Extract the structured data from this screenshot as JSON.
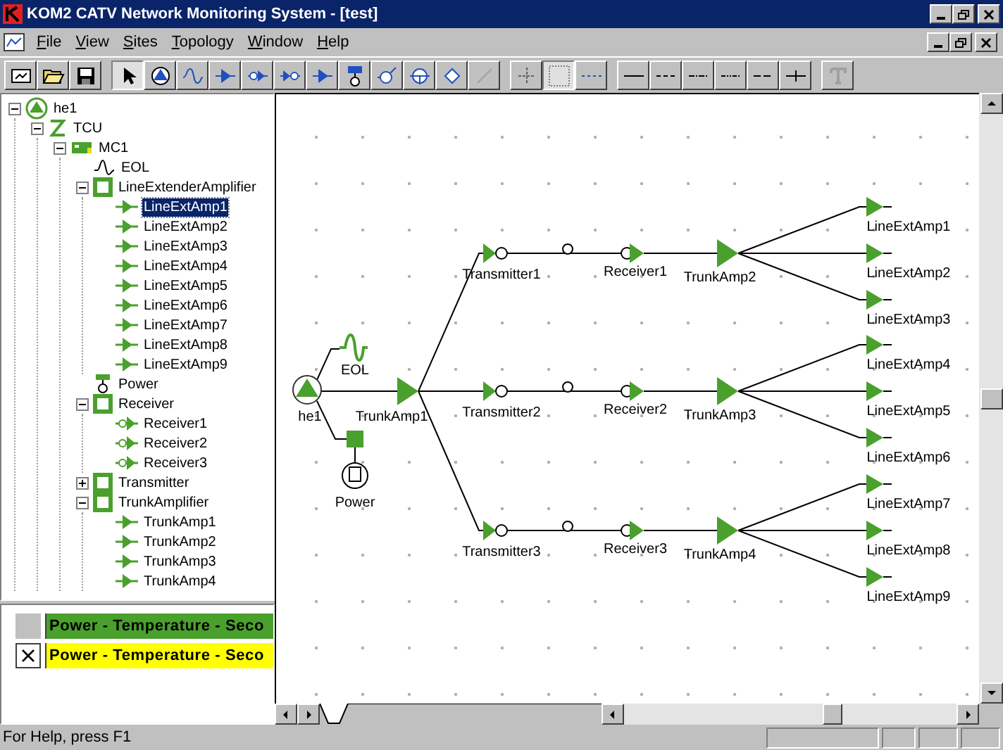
{
  "window": {
    "title": "KOM2 CATV Network Monitoring System - [test]"
  },
  "menu": [
    "File",
    "View",
    "Sites",
    "Topology",
    "Window",
    "Help"
  ],
  "toolbar": [
    {
      "kind": "new",
      "pressed": false
    },
    {
      "kind": "open",
      "pressed": false
    },
    {
      "kind": "save",
      "pressed": false
    },
    {
      "kind": "sep"
    },
    {
      "kind": "pointer",
      "pressed": true
    },
    {
      "kind": "headend",
      "pressed": false
    },
    {
      "kind": "eol",
      "pressed": false
    },
    {
      "kind": "amp",
      "pressed": false
    },
    {
      "kind": "receiver",
      "pressed": false
    },
    {
      "kind": "transmitter",
      "pressed": false
    },
    {
      "kind": "amp",
      "pressed": false
    },
    {
      "kind": "power",
      "pressed": false
    },
    {
      "kind": "tap",
      "pressed": false
    },
    {
      "kind": "node",
      "pressed": false
    },
    {
      "kind": "diamond",
      "pressed": false
    },
    {
      "kind": "line",
      "pressed": false
    },
    {
      "kind": "sep"
    },
    {
      "kind": "cross",
      "pressed": false
    },
    {
      "kind": "grid",
      "pressed": true
    },
    {
      "kind": "link",
      "pressed": false
    },
    {
      "kind": "sep"
    },
    {
      "kind": "solid",
      "pressed": false
    },
    {
      "kind": "dash",
      "pressed": false
    },
    {
      "kind": "dashdot",
      "pressed": false
    },
    {
      "kind": "dashdotdot",
      "pressed": false
    },
    {
      "kind": "longdash",
      "pressed": false
    },
    {
      "kind": "tee",
      "pressed": false
    },
    {
      "kind": "sep"
    },
    {
      "kind": "text",
      "pressed": false
    }
  ],
  "tree": [
    {
      "label": "he1",
      "kind": "headend",
      "selected": false,
      "expanded": true,
      "children": [
        {
          "label": "TCU",
          "kind": "tcu",
          "selected": false,
          "expanded": true,
          "children": [
            {
              "label": "MC1",
              "kind": "mc",
              "selected": false,
              "expanded": true,
              "children": [
                {
                  "label": "EOL",
                  "kind": "eol",
                  "selected": false
                },
                {
                  "label": "LineExtenderAmplifier",
                  "kind": "group",
                  "selected": false,
                  "expanded": true,
                  "children": [
                    {
                      "label": "LineExtAmp1",
                      "kind": "amp",
                      "selected": true
                    },
                    {
                      "label": "LineExtAmp2",
                      "kind": "amp",
                      "selected": false
                    },
                    {
                      "label": "LineExtAmp3",
                      "kind": "amp",
                      "selected": false
                    },
                    {
                      "label": "LineExtAmp4",
                      "kind": "amp",
                      "selected": false
                    },
                    {
                      "label": "LineExtAmp5",
                      "kind": "amp",
                      "selected": false
                    },
                    {
                      "label": "LineExtAmp6",
                      "kind": "amp",
                      "selected": false
                    },
                    {
                      "label": "LineExtAmp7",
                      "kind": "amp",
                      "selected": false
                    },
                    {
                      "label": "LineExtAmp8",
                      "kind": "amp",
                      "selected": false
                    },
                    {
                      "label": "LineExtAmp9",
                      "kind": "amp",
                      "selected": false
                    }
                  ]
                },
                {
                  "label": "Power",
                  "kind": "power",
                  "selected": false
                },
                {
                  "label": "Receiver",
                  "kind": "group",
                  "selected": false,
                  "expanded": true,
                  "children": [
                    {
                      "label": "Receiver1",
                      "kind": "receiver",
                      "selected": false
                    },
                    {
                      "label": "Receiver2",
                      "kind": "receiver",
                      "selected": false
                    },
                    {
                      "label": "Receiver3",
                      "kind": "receiver",
                      "selected": false
                    }
                  ]
                },
                {
                  "label": "Transmitter",
                  "kind": "group",
                  "selected": false,
                  "expanded": false
                },
                {
                  "label": "TrunkAmplifier",
                  "kind": "group",
                  "selected": false,
                  "expanded": true,
                  "children": [
                    {
                      "label": "TrunkAmp1",
                      "kind": "amp",
                      "selected": false
                    },
                    {
                      "label": "TrunkAmp2",
                      "kind": "amp",
                      "selected": false
                    },
                    {
                      "label": "TrunkAmp3",
                      "kind": "amp",
                      "selected": false
                    },
                    {
                      "label": "TrunkAmp4",
                      "kind": "amp",
                      "selected": false
                    }
                  ]
                }
              ]
            }
          ]
        }
      ]
    }
  ],
  "alarms": [
    {
      "text": "Power - Temperature - Seco",
      "checked": false,
      "color": "#4aa02c"
    },
    {
      "text": "Power - Temperature - Seco",
      "checked": true,
      "color": "#ffff00"
    }
  ],
  "diagram": {
    "nodes": [
      {
        "kind": "headend",
        "label": "he1"
      },
      {
        "kind": "eol",
        "label": "EOL"
      },
      {
        "kind": "trunk",
        "label": "TrunkAmp1"
      },
      {
        "kind": "power",
        "label": "Power"
      },
      {
        "kind": "transmitter",
        "label": "Transmitter1"
      },
      {
        "kind": "tap"
      },
      {
        "kind": "receiver",
        "label": "Receiver1"
      },
      {
        "kind": "trunk",
        "label": "TrunkAmp2"
      },
      {
        "kind": "lineext",
        "label": "LineExtAmp1"
      },
      {
        "kind": "lineext",
        "label": "LineExtAmp2"
      },
      {
        "kind": "lineext",
        "label": "LineExtAmp3"
      },
      {
        "kind": "transmitter",
        "label": "Transmitter2"
      },
      {
        "kind": "tap"
      },
      {
        "kind": "receiver",
        "label": "Receiver2"
      },
      {
        "kind": "trunk",
        "label": "TrunkAmp3"
      },
      {
        "kind": "lineext",
        "label": "LineExtAmp4"
      },
      {
        "kind": "lineext",
        "label": "LineExtAmp5"
      },
      {
        "kind": "lineext",
        "label": "LineExtAmp6"
      },
      {
        "kind": "transmitter",
        "label": "Transmitter3"
      },
      {
        "kind": "tap"
      },
      {
        "kind": "receiver",
        "label": "Receiver3"
      },
      {
        "kind": "trunk",
        "label": "TrunkAmp4"
      },
      {
        "kind": "lineext",
        "label": "LineExtAmp7"
      },
      {
        "kind": "lineext",
        "label": "LineExtAmp8"
      },
      {
        "kind": "lineext",
        "label": "LineExtAmp9"
      }
    ]
  },
  "status_bar": {
    "text": "For Help, press F1"
  }
}
